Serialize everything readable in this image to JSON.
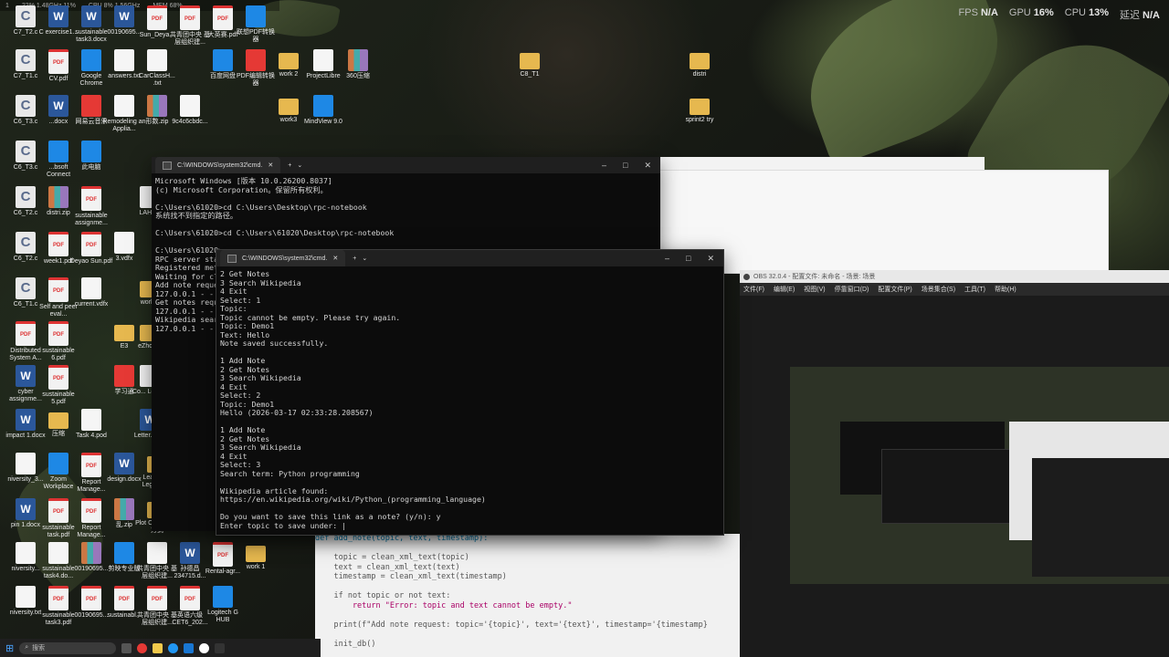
{
  "perf": {
    "fps_label": "FPS",
    "fps_value": "N/A",
    "gpu_label": "GPU",
    "gpu_value": "16%",
    "cpu_label": "CPU",
    "cpu_value": "13%",
    "latency_label": "延迟",
    "latency_value": "N/A"
  },
  "topstrip": [
    "1",
    "22% 1.48GHz 11%",
    "CPU 8% 1.56GHz",
    "MEM 68%"
  ],
  "desktop_icons": [
    {
      "label": "C7_T2.c",
      "type": "c"
    },
    {
      "label": "C exercise1...",
      "type": "doc"
    },
    {
      "label": "sustainable task3.docx",
      "type": "doc"
    },
    {
      "label": "00190695...",
      "type": "doc"
    },
    {
      "label": "Sun_Deya...",
      "type": "pdf"
    },
    {
      "label": "共青团中央 基层组织建...",
      "type": "pdf"
    },
    {
      "label": "大英赛.pdf",
      "type": "pdf"
    },
    {
      "label": "联想PDF转换器",
      "type": "app"
    },
    {
      "label": "C7_T1.c",
      "type": "c"
    },
    {
      "label": "CV.pdf",
      "type": "pdf"
    },
    {
      "label": "Google Chrome",
      "type": "app"
    },
    {
      "label": "answers.txt",
      "type": "file"
    },
    {
      "label": "CarClassH... .txt",
      "type": "file"
    },
    {
      "label": "百度网盘",
      "type": "app"
    },
    {
      "label": "PDF编辑转换器",
      "type": "red"
    },
    {
      "label": "work 2",
      "type": "folder"
    },
    {
      "label": "ProjectLibre",
      "type": "file"
    },
    {
      "label": "360压缩",
      "type": "zip"
    },
    {
      "label": "C8_T1",
      "type": "folder"
    },
    {
      "label": "distri",
      "type": "folder"
    },
    {
      "label": "C6_T3.c",
      "type": "c"
    },
    {
      "label": "...docx",
      "type": "doc"
    },
    {
      "label": "网易云音乐",
      "type": "red"
    },
    {
      "label": "Remodeling an Applia...",
      "type": "file"
    },
    {
      "label": "形数.zip",
      "type": "zip"
    },
    {
      "label": "9c4c6cbdc...",
      "type": "file"
    },
    {
      "label": "work3",
      "type": "folder"
    },
    {
      "label": "MindView 9.0",
      "type": "app"
    },
    {
      "label": "sprint2 try",
      "type": "folder"
    },
    {
      "label": "C6_T3.c",
      "type": "c"
    },
    {
      "label": "...bsoft Connect",
      "type": "app"
    },
    {
      "label": "此电脑",
      "type": "app"
    },
    {
      "label": "C6_T2.c",
      "type": "c"
    },
    {
      "label": "distri.zip",
      "type": "zip"
    },
    {
      "label": "sustainable assignme...",
      "type": "pdf"
    },
    {
      "label": "LAHT...",
      "type": "file"
    },
    {
      "label": "C6_T2.c",
      "type": "c"
    },
    {
      "label": "week1.pdf",
      "type": "pdf"
    },
    {
      "label": "Deyao Sun.pdf",
      "type": "pdf"
    },
    {
      "label": "3.vdfx",
      "type": "file"
    },
    {
      "label": "C6_T1.c",
      "type": "c"
    },
    {
      "label": "Self and peer eval...",
      "type": "pdf"
    },
    {
      "label": "current.vdfx",
      "type": "file"
    },
    {
      "label": "work...",
      "type": "folder"
    },
    {
      "label": "Distributed System A...",
      "type": "pdf"
    },
    {
      "label": "sustainable 6.pdf",
      "type": "pdf"
    },
    {
      "label": "E3",
      "type": "folder"
    },
    {
      "label": "eZhou...",
      "type": "folder"
    },
    {
      "label": "cyber assignme...",
      "type": "doc"
    },
    {
      "label": "sustainable 5.pdf",
      "type": "pdf"
    },
    {
      "label": "学习通",
      "type": "red"
    },
    {
      "label": "Co... Lette...",
      "type": "file"
    },
    {
      "label": "impact 1.docx",
      "type": "doc"
    },
    {
      "label": "压缩",
      "type": "folder"
    },
    {
      "label": "Task 4.pod",
      "type": "file"
    },
    {
      "label": "Letter.docx",
      "type": "doc"
    },
    {
      "label": "niversity_3...",
      "type": "file"
    },
    {
      "label": "Zoom Workplace",
      "type": "app"
    },
    {
      "label": "Report Manage...",
      "type": "pdf"
    },
    {
      "label": "design.docx",
      "type": "doc"
    },
    {
      "label": "League of Legends...",
      "type": "folder"
    },
    {
      "label": "孙德昌.pdf",
      "type": "pdf"
    },
    {
      "label": "pin 1.docx",
      "type": "doc"
    },
    {
      "label": "sustainable task.pdf",
      "type": "pdf"
    },
    {
      "label": "Report Manage...",
      "type": "pdf"
    },
    {
      "label": "乱.zip",
      "type": "zip"
    },
    {
      "label": "Plot Client 快捷方式",
      "type": "folder"
    },
    {
      "label": "孙德昌.zip",
      "type": "zip"
    },
    {
      "label": "niversity...",
      "type": "file"
    },
    {
      "label": "sustainable task4.do...",
      "type": "file"
    },
    {
      "label": "00190695...",
      "type": "zip"
    },
    {
      "label": "剪映专业版",
      "type": "app"
    },
    {
      "label": "共青团中央 基层组织建...",
      "type": "file"
    },
    {
      "label": "孙德昌 234715.d...",
      "type": "doc"
    },
    {
      "label": "Rental-agr...",
      "type": "pdf"
    },
    {
      "label": "work 1",
      "type": "folder"
    },
    {
      "label": "niversity.txt",
      "type": "file"
    },
    {
      "label": "sustainable task3.pdf",
      "type": "pdf"
    },
    {
      "label": "00190695...",
      "type": "pdf"
    },
    {
      "label": "sustainabl...",
      "type": "pdf"
    },
    {
      "label": "共青团中央 基层组织建...",
      "type": "pdf"
    },
    {
      "label": "英语六级 CET6_202...",
      "type": "pdf"
    },
    {
      "label": "Logitech G HUB",
      "type": "app"
    }
  ],
  "terminal1": {
    "tab_title": "C:\\WINDOWS\\system32\\cmd.",
    "lines": [
      "Microsoft Windows [版本 10.0.26200.8037]",
      "(c) Microsoft Corporation。保留所有权利。",
      "",
      "C:\\Users\\61020>cd C:\\Users\\Desktop\\rpc-notebook",
      "系统找不到指定的路径。",
      "",
      "C:\\Users\\61020>cd C:\\Users\\61020\\Desktop\\rpc-notebook",
      "",
      "C:\\Users\\61020>",
      "RPC server sta",
      "Registered met",
      "Waiting for cl",
      "Add note reque",
      "127.0.0.1 - -",
      "Get notes requ",
      "127.0.0.1 - -",
      "Wikipedia sear",
      "127.0.0.1 - -"
    ]
  },
  "terminal2": {
    "tab_title": "C:\\WINDOWS\\system32\\cmd.",
    "lines": [
      "2 Get Notes",
      "3 Search Wikipedia",
      "4 Exit",
      "Select: 1",
      "Topic:",
      "Topic cannot be empty. Please try again.",
      "Topic: Demo1",
      "Text: Hello",
      "Note saved successfully.",
      "",
      "1 Add Note",
      "2 Get Notes",
      "3 Search Wikipedia",
      "4 Exit",
      "Select: 2",
      "Topic: Demo1",
      "Hello (2026-03-17 02:33:28.208567)",
      "",
      "1 Add Note",
      "2 Get Notes",
      "3 Search Wikipedia",
      "4 Exit",
      "Select: 3",
      "Search term: Python programming",
      "",
      "Wikipedia article found:",
      "https://en.wikipedia.org/wiki/Python_(programming_language)",
      "",
      "Do you want to save this link as a note? (y/n): y",
      "Enter topic to save under: |"
    ]
  },
  "editor": {
    "lines": [
      "def add_note(topic, text, timestamp):",
      "",
      "    topic = clean_xml_text(topic)",
      "    text = clean_xml_text(text)",
      "    timestamp = clean_xml_text(timestamp)",
      "",
      "    if not topic or not text:",
      "        return \"Error: topic and text cannot be empty.\"",
      "",
      "    print(f\"Add note request: topic='{topic}', text='{text}', timestamp='{timestamp}",
      "",
      "    init_db()"
    ]
  },
  "obs": {
    "title": "OBS 32.0.4 - 配置文件: 未命名 - 场景: 场景",
    "menu": [
      "文件(F)",
      "编辑(E)",
      "视图(V)",
      "停靠窗口(D)",
      "配置文件(P)",
      "场景集合(S)",
      "工具(T)",
      "帮助(H)"
    ]
  },
  "taskbar": {
    "search_placeholder": "搜索"
  }
}
